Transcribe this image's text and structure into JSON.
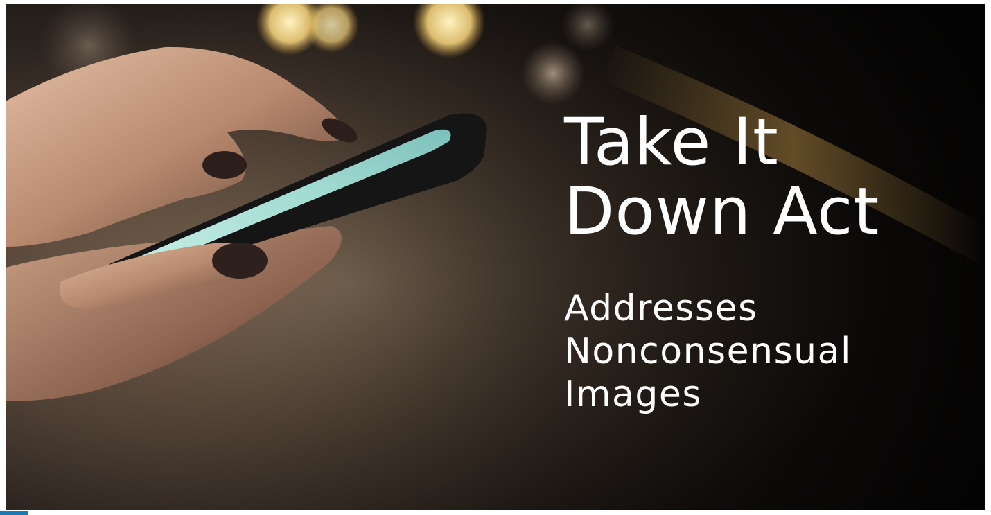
{
  "headline": {
    "line1": "Take It",
    "line2": "Down Act"
  },
  "subhead": {
    "line1": "Addresses",
    "line2": "Nonconsensual",
    "line3": "Images"
  },
  "colors": {
    "text": "#ffffff",
    "background_dark": "#1c1815",
    "accent_blue": "#1a7ab8"
  },
  "icons": {
    "photo": "hands-holding-smartphone"
  }
}
